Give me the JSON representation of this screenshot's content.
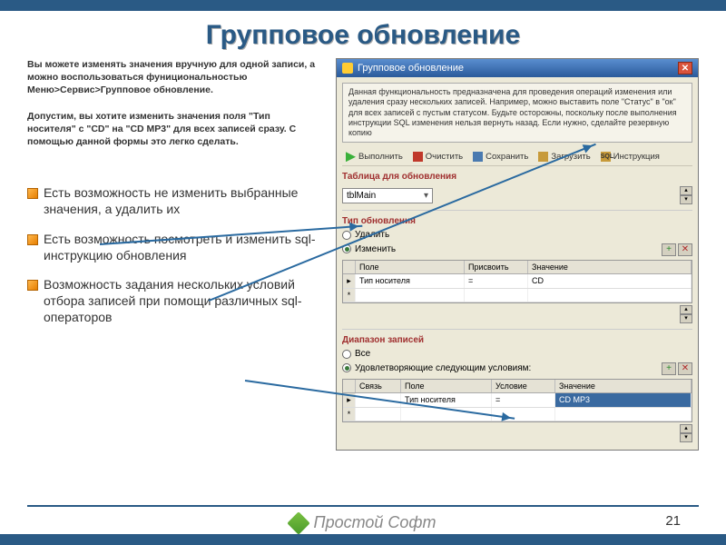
{
  "title": "Групповое обновление",
  "intro_p1": "Вы можете изменять значения вручную для одной записи, а можно воспользоваться фунициональностью Меню>Сервис>Групповое обновление.",
  "intro_p2": "Допустим, вы хотите изменить значения поля \"Тип носителя\" с \"CD\" на \"CD MP3\" для всех записей сразу. С помощью данной формы это легко сделать.",
  "bullets": [
    "Есть возможность не изменить выбранные значения, а удалить их",
    "Есть возможность посмотреть и изменить sql-инструкцию обновления",
    "Возможность задания нескольких условий отбора записей при помощи различных sql-операторов"
  ],
  "win": {
    "title": "Групповое обновление",
    "desc": "Данная функциональность предназначена для проведения операций изменения или удаления сразу нескольких записей. Например, можно выставить поле \"Статус\" в \"ок\" для всех записей с пустым статусом. Будьте осторожны, поскольку после выполнения инструкции SQL изменения нельзя вернуть назад. Если нужно, сделайте резервную копию",
    "toolbar": {
      "run": "Выполнить",
      "clear": "Очистить",
      "save": "Сохранить",
      "load": "Загрузить",
      "sql": "Инструкция",
      "sql_badge": "SQL"
    },
    "sec_table": "Таблица для обновления",
    "table_name": "tblMain",
    "sec_updtype": "Тип обновления",
    "radio_delete": "Удалить",
    "radio_modify": "Изменить",
    "grid1": {
      "h1": "Поле",
      "h2": "Присвоить",
      "h3": "Значение",
      "r1c1": "Тип носителя",
      "r1c2": "=",
      "r1c3": "CD"
    },
    "sec_range": "Диапазон записей",
    "radio_all": "Все",
    "radio_cond": "Удовлетворяющие следующим условиям:",
    "grid2": {
      "h0": "Связь",
      "h1": "Поле",
      "h2": "Условие",
      "h3": "Значение",
      "r1c1": "Тип носителя",
      "r1c2": "=",
      "r1c3": "CD MP3"
    }
  },
  "footer_brand": "Простой Софт",
  "page_number": "21"
}
